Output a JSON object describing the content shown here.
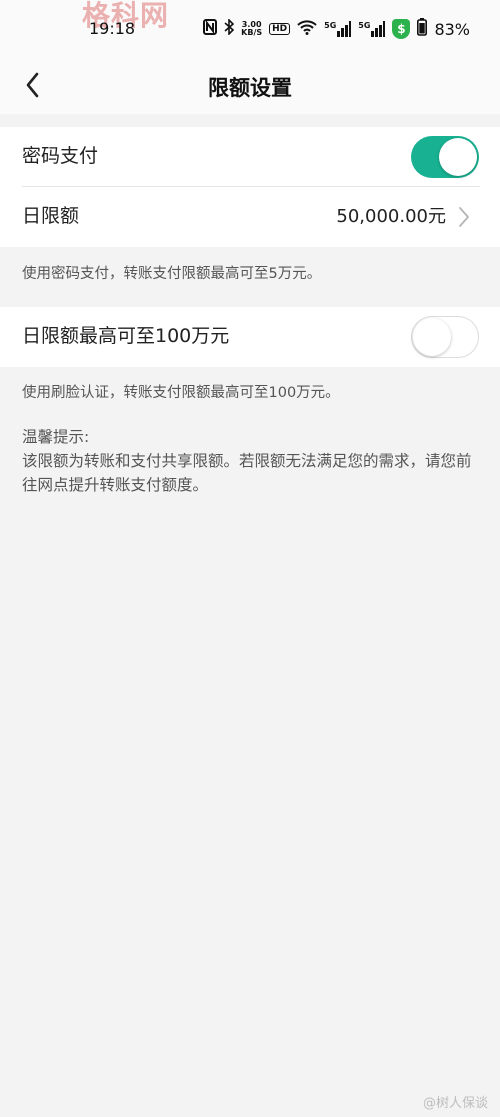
{
  "status_bar": {
    "time": "19:18",
    "speed_value": "3.00",
    "speed_unit": "KB/S",
    "hd": "HD",
    "signal_1": "5G",
    "signal_2": "5G",
    "shield_glyph": "$",
    "battery": "83%",
    "icons": [
      "nfc-icon",
      "bluetooth-icon",
      "wifi-icon",
      "signal-icon",
      "shield-icon",
      "battery-icon"
    ]
  },
  "watermark_top": "格科网",
  "nav": {
    "title": "限额设置",
    "back_icon": "chevron-left-icon"
  },
  "password_pay": {
    "label": "密码支付",
    "enabled": true
  },
  "daily_limit": {
    "label": "日限额",
    "value": "50,000.00元"
  },
  "hint_password": "使用密码支付，转账支付限额最高可至5万元。",
  "face_limit": {
    "label": "日限额最高可至100万元",
    "enabled": false
  },
  "hint_face": "使用刷脸认证，转账支付限额最高可至100万元。",
  "tips": {
    "title": "温馨提示:",
    "body": "该限额为转账和支付共享限额。若限额无法满足您的需求，请您前往网点提升转账支付额度。"
  },
  "watermark_bottom": "@树人保谈",
  "colors": {
    "toggle_on": "#18b292",
    "background": "#f3f3f3",
    "card": "#ffffff"
  }
}
